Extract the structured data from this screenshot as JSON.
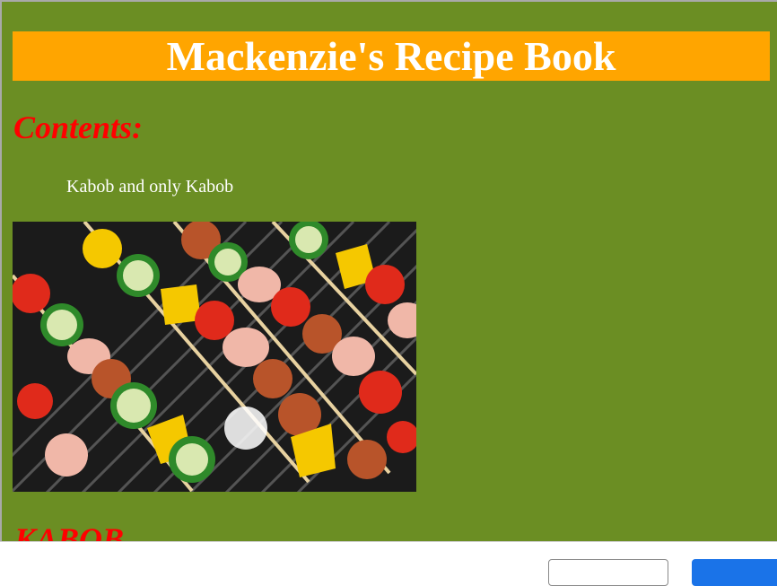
{
  "page": {
    "title": "Mackenzie's Recipe Book",
    "contents_heading": "Contents:",
    "contents_items": [
      "Kabob and only Kabob"
    ],
    "section_heading": "KABOB",
    "photo_alt": "Grilled kabob skewers"
  },
  "colors": {
    "background": "#6b8e23",
    "title_bar": "#ffa500",
    "heading": "#ff0000",
    "primary_button": "#1a73e8"
  },
  "footer": {
    "secondary_button_label": "",
    "primary_button_label": ""
  }
}
